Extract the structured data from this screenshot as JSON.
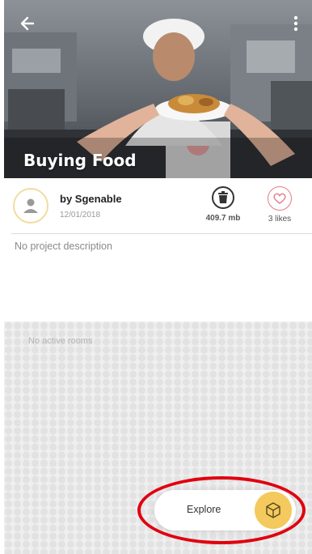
{
  "header": {
    "title": "Buying Food",
    "back_icon": "arrow-left-icon",
    "more_icon": "more-vertical-icon"
  },
  "project": {
    "author": "by Sgenable",
    "date": "12/01/2018",
    "size": "409.7 mb",
    "likes": "3 likes",
    "description": "No project description"
  },
  "rooms": {
    "empty_text": "No active rooms",
    "explore_label": "Explore",
    "explore_icon": "cube-icon"
  },
  "colors": {
    "accent_yellow": "#f4c95d",
    "like_pink": "#e57a88",
    "highlight_red": "#e0000f"
  }
}
